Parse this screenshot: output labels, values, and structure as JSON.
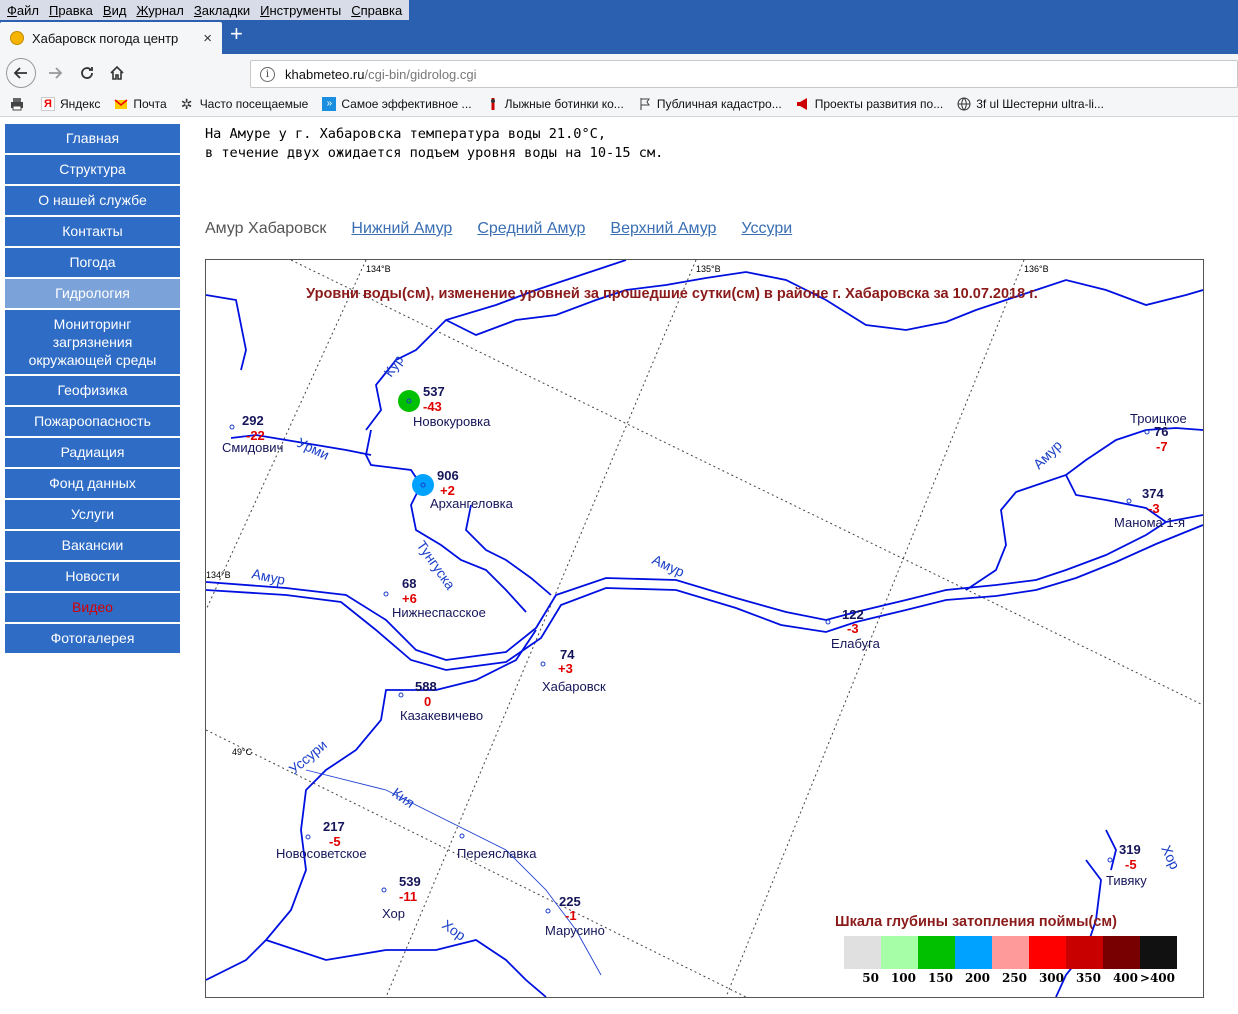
{
  "menubar": [
    "Файл",
    "Правка",
    "Вид",
    "Журнал",
    "Закладки",
    "Инструменты",
    "Справка"
  ],
  "tab": {
    "title": "Хабаровск погода центр",
    "close": "×",
    "new": "+"
  },
  "url": {
    "host": "khabmeteo.ru",
    "path": "/cgi-bin/gidrolog.cgi"
  },
  "bookmarks": [
    {
      "label": "Яндекс",
      "icon": "yandex-icon"
    },
    {
      "label": "Почта",
      "icon": "mail-icon"
    },
    {
      "label": "Часто посещаемые",
      "icon": "gear-icon"
    },
    {
      "label": "Самое эффективное ...",
      "icon": "arrow-icon"
    },
    {
      "label": "Лыжные ботинки ко...",
      "icon": "ski-icon"
    },
    {
      "label": "Публичная кадастро...",
      "icon": "flag-icon"
    },
    {
      "label": "Проекты развития по...",
      "icon": "megaphone-icon"
    },
    {
      "label": "3f ul Шестерни ultra-li...",
      "icon": "globe-icon"
    }
  ],
  "sidebar": [
    {
      "label": "Главная"
    },
    {
      "label": "Структура"
    },
    {
      "label": "О нашей службе"
    },
    {
      "label": "Контакты"
    },
    {
      "label": "Погода"
    },
    {
      "label": "Гидрология",
      "active": true
    },
    {
      "label": "Мониторинг загрязнения окружающей среды",
      "multi": true
    },
    {
      "label": "Геофизика"
    },
    {
      "label": "Пожароопасность"
    },
    {
      "label": "Радиация"
    },
    {
      "label": "Фонд данных"
    },
    {
      "label": "Услуги"
    },
    {
      "label": "Вакансии"
    },
    {
      "label": "Новости"
    },
    {
      "label": "Видео",
      "red": true
    },
    {
      "label": "Фотогалерея"
    }
  ],
  "intro": {
    "line1": "На Амуре у г. Хабаровска температура воды 21.0°С,",
    "line2": "в течение двух ожидается подъем уровня воды на 10-15 см."
  },
  "region_tabs": {
    "current": "Амур Хабаровск",
    "links": [
      "Нижний Амур",
      "Средний Амур",
      "Верхний Амур",
      "Уссури"
    ]
  },
  "map": {
    "title": "Уровни воды(см), изменение уровней за прошедшие сутки(см) в районе г. Хабаровска за 10.07.2018 г.",
    "grid_labels": {
      "lon1": "134°В",
      "lon2": "135°В",
      "lon3": "136°В",
      "lon_side": "134°В",
      "lat": "49°С"
    },
    "rivers": [
      "Кур",
      "Урми",
      "Тунгуска",
      "Амур",
      "Амур",
      "Амур",
      "Уссури",
      "Кия",
      "Хор",
      "Хор"
    ],
    "stations": [
      {
        "name": "Новокуровка",
        "level": "537",
        "change": "-43",
        "flood": "150"
      },
      {
        "name": "Смидович",
        "level": "292",
        "change": "-22"
      },
      {
        "name": "Архангеловка",
        "level": "906",
        "change": "+2",
        "flood": "200"
      },
      {
        "name": "Троицкое",
        "level": "76",
        "change": "-7"
      },
      {
        "name": "Манома 1-я",
        "level": "374",
        "change": "-3"
      },
      {
        "name": "Нижнеспасское",
        "level": "68",
        "change": "+6"
      },
      {
        "name": "Елабуга",
        "level": "122",
        "change": "-3"
      },
      {
        "name": "Хабаровск",
        "level": "74",
        "change": "+3"
      },
      {
        "name": "Казакевичево",
        "level": "588",
        "change": "0"
      },
      {
        "name": "Новосоветское",
        "level": "217",
        "change": "-5"
      },
      {
        "name": "Переяславка",
        "level": "",
        "change": ""
      },
      {
        "name": "Хор",
        "level": "539",
        "change": "-11"
      },
      {
        "name": "Марусино",
        "level": "225",
        "change": "-1"
      },
      {
        "name": "Тивяку",
        "level": "319",
        "change": "-5"
      }
    ],
    "legend": {
      "title": "Шкала глубины затопления поймы(см)",
      "items": [
        {
          "label": "50",
          "color": "#e0e0e0"
        },
        {
          "label": "100",
          "color": "#a6ffa6"
        },
        {
          "label": "150",
          "color": "#00c000"
        },
        {
          "label": "200",
          "color": "#00a2ff"
        },
        {
          "label": "250",
          "color": "#ff9a9a"
        },
        {
          "label": "300",
          "color": "#ff0000"
        },
        {
          "label": "350",
          "color": "#c80000"
        },
        {
          "label": "400",
          "color": "#780000"
        },
        {
          "label": ">400",
          "color": "#111111"
        }
      ]
    }
  }
}
